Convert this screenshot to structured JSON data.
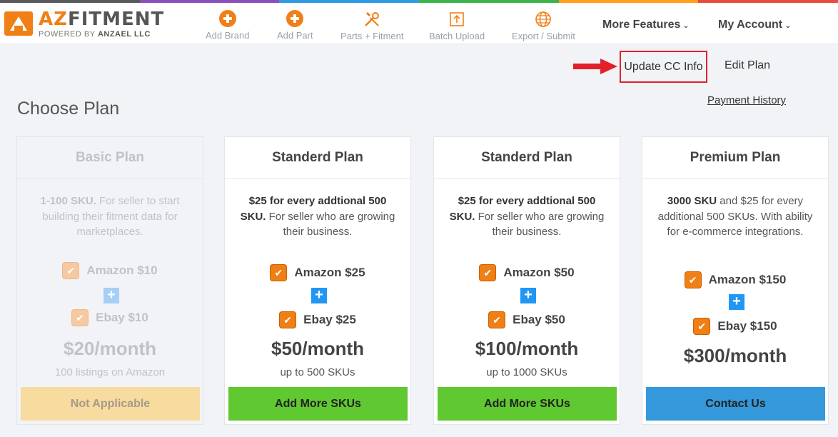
{
  "colors": {
    "accent_orange": "#f07f16",
    "add_green": "#60c830",
    "contact_blue": "#3498db",
    "plus_blue": "#2196f3",
    "highlight_red": "#e2202a",
    "strip": [
      "#58595b",
      "#8a4fbf",
      "#2d9be3",
      "#3cb44b",
      "#ff9f1c",
      "#e94b3c"
    ]
  },
  "brand": {
    "name_prefix": "AZ",
    "name_suffix": "FITMENT",
    "powered_by_prefix": "POWERED BY ",
    "powered_by_company": "ANZAEL LLC"
  },
  "nav": {
    "items": [
      {
        "label": "Add Brand",
        "icon": "add-circle-icon"
      },
      {
        "label": "Add Part",
        "icon": "add-circle-icon"
      },
      {
        "label": "Parts + Fitment",
        "icon": "wrench-screwdriver-icon"
      },
      {
        "label": "Batch Upload",
        "icon": "upload-icon"
      },
      {
        "label": "Export / Submit",
        "icon": "globe-icon"
      }
    ],
    "more_features": "More Features",
    "my_account": "My Account"
  },
  "actions": {
    "update_cc": "Update CC Info",
    "edit_plan": "Edit Plan",
    "payment_history": "Payment History"
  },
  "page_title": "Choose Plan",
  "plans": [
    {
      "name": "Basic Plan",
      "desc_bold": "1-100 SKU.",
      "desc_rest": " For seller to start building their fitment data for marketplaces.",
      "opt1": "Amazon $10",
      "opt2": "Ebay $10",
      "price": "$20/month",
      "sub": "100 listings on Amazon",
      "button": "Not Applicable",
      "disabled": true
    },
    {
      "name": "Standerd Plan",
      "desc_bold": "$25 for every addtional 500 SKU.",
      "desc_rest": " For seller who are growing their business.",
      "opt1": "Amazon $25",
      "opt2": "Ebay $25",
      "price": "$50/month",
      "sub": "up to 500 SKUs",
      "button": "Add More SKUs",
      "disabled": false
    },
    {
      "name": "Standerd Plan",
      "desc_bold": "$25 for every addtional 500 SKU.",
      "desc_rest": " For seller who are growing their business.",
      "opt1": "Amazon $50",
      "opt2": "Ebay $50",
      "price": "$100/month",
      "sub": "up to 1000 SKUs",
      "button": "Add More SKUs",
      "disabled": false
    },
    {
      "name": "Premium Plan",
      "desc_bold": "3000 SKU",
      "desc_rest": " and $25 for every additional 500 SKUs. With ability for e-commerce integrations.",
      "opt1": "Amazon $150",
      "opt2": "Ebay $150",
      "price": "$300/month",
      "sub": "",
      "button": "Contact Us",
      "disabled": false
    }
  ]
}
